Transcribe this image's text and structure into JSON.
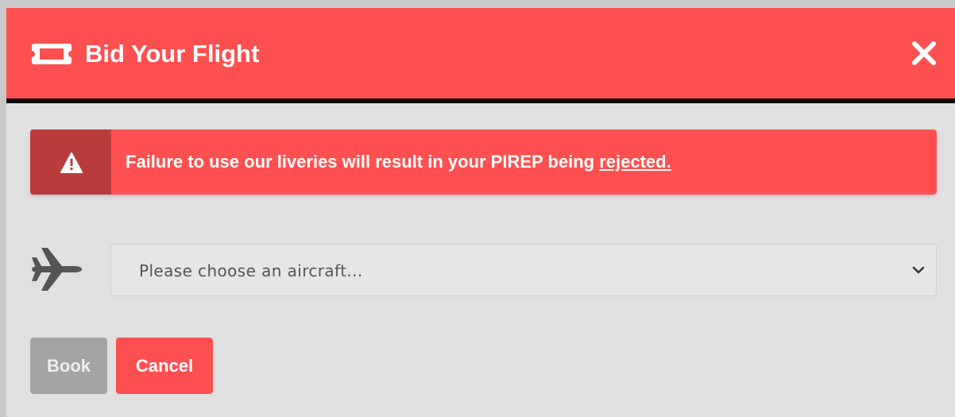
{
  "modal": {
    "title": "Bid Your Flight",
    "header_icon": "ticket-icon",
    "close_icon": "close-icon"
  },
  "alert": {
    "icon": "warning-icon",
    "message": "Failure to use our liveries will result in your PIREP being ",
    "link_text": "rejected."
  },
  "aircraft_select": {
    "icon": "plane-icon",
    "placeholder": "Please choose an aircraft...",
    "chevron": "chevron-down-icon"
  },
  "buttons": {
    "book_label": "Book",
    "cancel_label": "Cancel"
  },
  "colors": {
    "primary_red": "#fe5050",
    "alert_icon_bg": "#b93c3c",
    "modal_body": "#e0e0e0",
    "disabled_button": "#a4a4a4"
  }
}
